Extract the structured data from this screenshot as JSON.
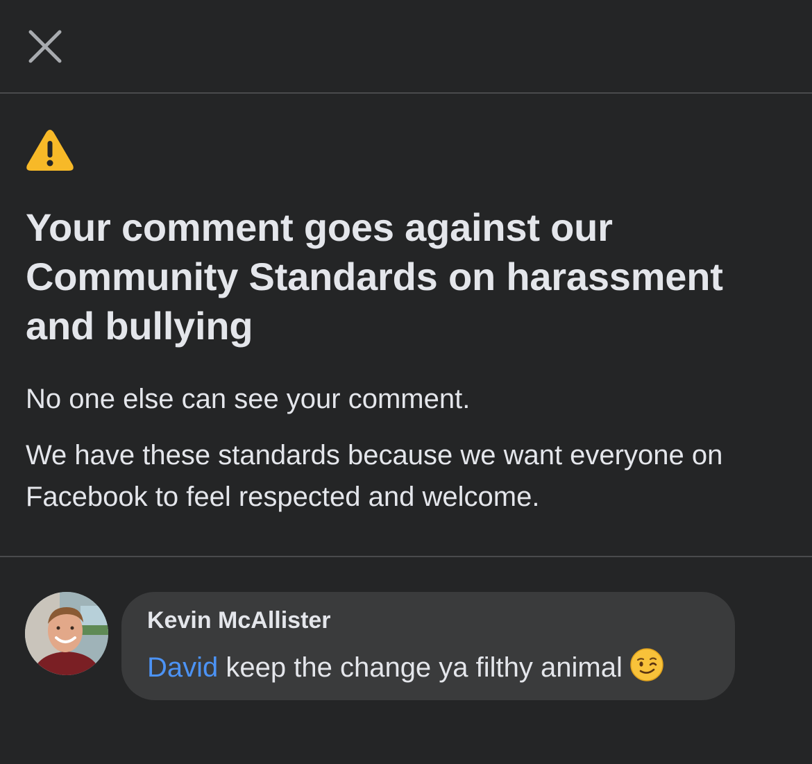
{
  "header": {
    "close_icon": "close-icon"
  },
  "notice": {
    "icon": "warning-triangle-icon",
    "title": "Your comment goes against our Community Standards on harassment and bullying",
    "visibility_text": "No one else can see your comment.",
    "reason_text": "We have these standards because we want everyone on Facebook to feel respected and welcome."
  },
  "comment": {
    "author": "Kevin McAllister",
    "mention": "David",
    "text": " keep the change ya filthy animal",
    "emoji": "winking-face-emoji"
  },
  "colors": {
    "background": "#242526",
    "bubble": "#3a3b3c",
    "text": "#e4e6eb",
    "mention": "#4c93f5",
    "warning": "#f7b928",
    "divider": "#4a4b4d"
  }
}
